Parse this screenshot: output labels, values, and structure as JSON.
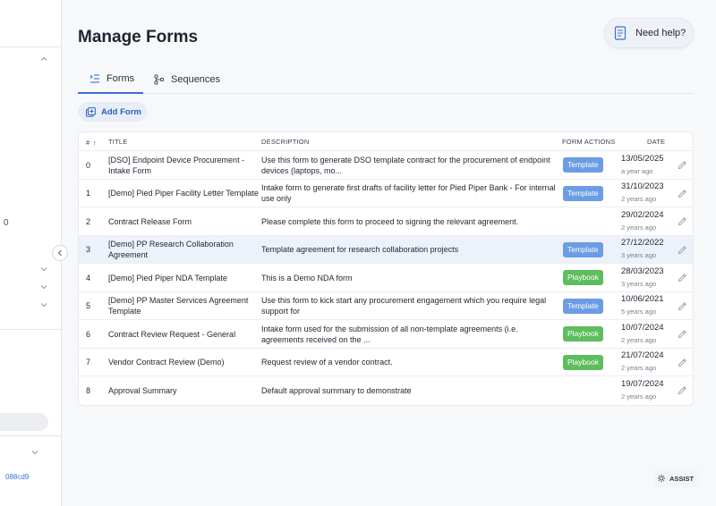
{
  "sidebar": {
    "truncated_value": "0",
    "truncated_link": "088cd9",
    "collapse_icon": "chevron-left-icon"
  },
  "header": {
    "title": "Manage Forms",
    "help_label": "Need help?"
  },
  "tabs": [
    {
      "label": "Forms",
      "icon": "form-list-icon",
      "active": true
    },
    {
      "label": "Sequences",
      "icon": "sequence-icon",
      "active": false
    }
  ],
  "toolbar": {
    "add_label": "Add Form"
  },
  "table": {
    "columns": {
      "num": "#",
      "title": "TITLE",
      "description": "DESCRIPTION",
      "actions": "FORM ACTIONS",
      "date": "DATE"
    },
    "rows": [
      {
        "num": "0",
        "title": "[DSO] Endpoint Device Procurement - Intake Form",
        "description": "Use this form to generate DSO template contract for the procurement of endpoint devices (laptops, mo...",
        "action": "Template",
        "date": "13/05/2025",
        "ago": "a year ago"
      },
      {
        "num": "1",
        "title": "[Demo] Pied Piper Facility Letter Template",
        "description": "Intake form to generate first drafts of facility letter for Pied Piper Bank - For internal use only",
        "action": "Template",
        "date": "31/10/2023",
        "ago": "2 years ago"
      },
      {
        "num": "2",
        "title": "Contract Release Form",
        "description": "Please complete this form to proceed to signing the relevant agreement.",
        "action": "",
        "date": "29/02/2024",
        "ago": "2 years ago"
      },
      {
        "num": "3",
        "title": "[Demo] PP Research Collaboration Agreement",
        "description": "Template agreement for research collaboration projects",
        "action": "Template",
        "date": "27/12/2022",
        "ago": "3 years ago"
      },
      {
        "num": "4",
        "title": "[Demo] Pied Piper NDA Template",
        "description": "This is a Demo NDA form",
        "action": "Playbook",
        "date": "28/03/2023",
        "ago": "3 years ago"
      },
      {
        "num": "5",
        "title": "[Demo] PP Master Services Agreement Template",
        "description": "Use this form to kick start any procurement engagement which you require legal support for",
        "action": "Template",
        "date": "10/06/2021",
        "ago": "5 years ago"
      },
      {
        "num": "6",
        "title": "Contract Review Request - General",
        "description": "Intake form used for the submission of all non-template agreements (i.e. agreements received on the ...",
        "action": "Playbook",
        "date": "10/07/2024",
        "ago": "2 years ago"
      },
      {
        "num": "7",
        "title": "Vendor Contract Review (Demo)",
        "description": "Request review of a vendor contract.",
        "action": "Playbook",
        "date": "21/07/2024",
        "ago": "2 years ago"
      },
      {
        "num": "8",
        "title": "Approval Summary",
        "description": "Default approval summary to demonstrate",
        "action": "",
        "date": "19/07/2024",
        "ago": "2 years ago"
      }
    ]
  },
  "assist_label": "ASSIST",
  "colors": {
    "accent": "#3b6fd6",
    "template_badge": "#6c9ce6",
    "playbook_badge": "#5ebd5e",
    "highlight_row": "#edf2fa"
  }
}
